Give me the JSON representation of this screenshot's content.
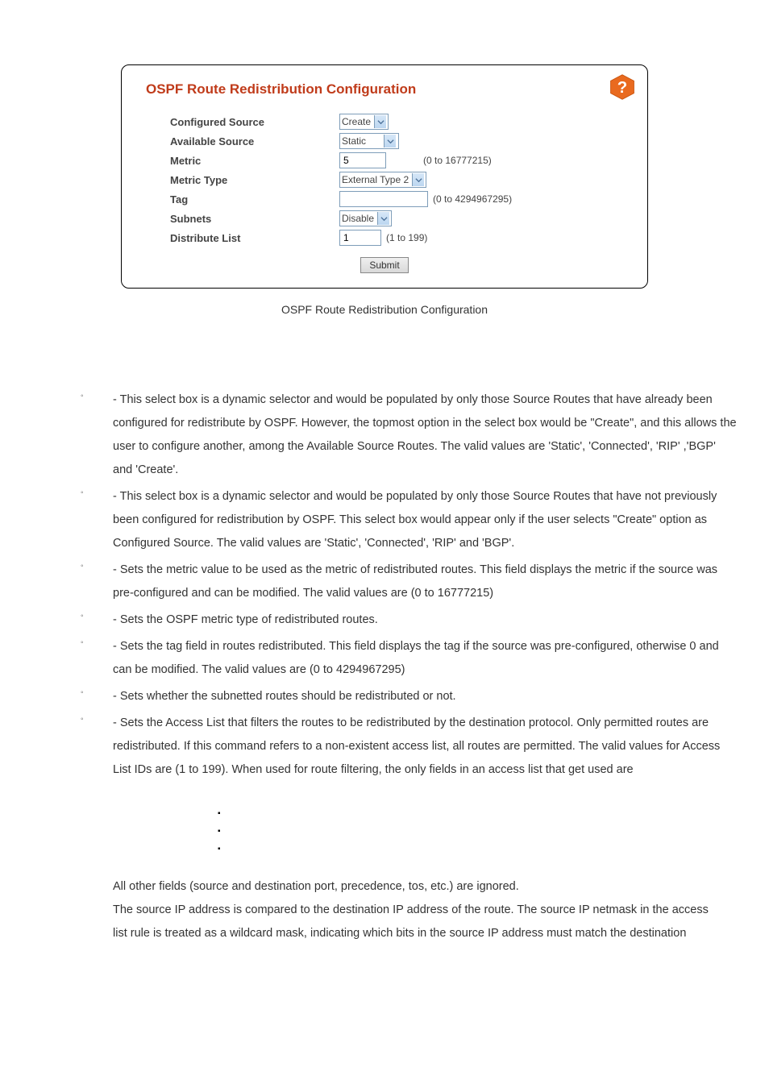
{
  "panel": {
    "title": "OSPF Route Redistribution Configuration",
    "caption": "OSPF Route Redistribution Configuration",
    "fields": {
      "configured_source": {
        "label": "Configured Source",
        "value": "Create"
      },
      "available_source": {
        "label": "Available Source",
        "value": "Static"
      },
      "metric": {
        "label": "Metric",
        "value": "5",
        "hint": "(0 to 16777215)"
      },
      "metric_type": {
        "label": "Metric Type",
        "value": "External Type 2"
      },
      "tag": {
        "label": "Tag",
        "value": "",
        "hint": "(0 to 4294967295)"
      },
      "subnets": {
        "label": "Subnets",
        "value": "Disable"
      },
      "distribute_list": {
        "label": "Distribute List",
        "value": "1",
        "hint": "(1 to 199)"
      }
    },
    "submit_label": "Submit"
  },
  "descriptions": {
    "configured_source": " - This select box is a dynamic selector and would be populated by only those Source Routes that have already been configured for redistribute by OSPF. However, the topmost option in the select box would be \"Create\", and this allows the user to configure another, among the Available Source Routes. The valid values are 'Static', 'Connected', 'RIP' ,'BGP' and 'Create'.",
    "available_source": " - This select box is a dynamic selector and would be populated by only those Source Routes that have not previously been configured for redistribution by OSPF. This select box would appear only if the user selects \"Create\" option as Configured Source. The valid values are 'Static', 'Connected', 'RIP' and 'BGP'.",
    "metric": " - Sets the metric value to be used as the metric of redistributed routes. This field displays the metric if the source was pre-configured and can be modified. The valid values are (0 to 16777215)",
    "metric_type": " - Sets the OSPF metric type of redistributed routes.",
    "tag": " - Sets the tag field in routes redistributed. This field displays the tag if the source was pre-configured, otherwise 0 and can be modified. The valid values are (0 to 4294967295)",
    "subnets": " - Sets whether the subnetted routes should be redistributed or not.",
    "distribute_list": " - Sets the Access List that filters the routes to be redistributed by the destination protocol. Only permitted routes are redistributed. If this command refers to a non-existent access list, all routes are permitted. The valid values for Access List IDs are (1 to 199). When used for route filtering, the only fields in an access list that get used are",
    "tail1": "All other fields (source and destination port, precedence, tos, etc.) are ignored.",
    "tail2": "The source IP address is compared to the destination IP address of the route. The source IP netmask in the access list rule is treated as a wildcard mask, indicating which bits in the source IP address must match the destination"
  }
}
